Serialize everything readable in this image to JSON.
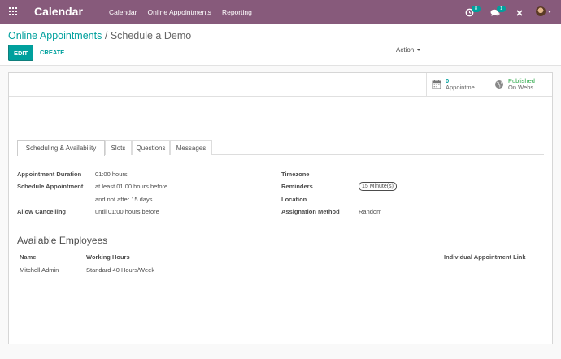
{
  "navbar": {
    "brand": "Calendar",
    "menu": [
      "Calendar",
      "Online Appointments",
      "Reporting"
    ],
    "activity_count": "8",
    "message_count": "1"
  },
  "breadcrumb": {
    "parent": "Online Appointments",
    "separator": "/",
    "current": "Schedule a Demo"
  },
  "controls": {
    "edit_label": "EDIT",
    "create_label": "CREATE",
    "action_label": "Action"
  },
  "smart_buttons": [
    {
      "value": "0",
      "label": "Appointme..."
    },
    {
      "value": "Published",
      "label": "On Webs..."
    }
  ],
  "tabs": [
    "Scheduling & Availability",
    "Slots",
    "Questions",
    "Messages"
  ],
  "fields_left": [
    {
      "label": "Appointment Duration",
      "value": "01:00 hours"
    },
    {
      "label": "Schedule Appointment",
      "value": "at least 01:00 hours before",
      "value2": "and not after 15 days"
    },
    {
      "label": "Allow Cancelling",
      "value": "until 01:00 hours before"
    }
  ],
  "fields_right": [
    {
      "label": "Timezone",
      "value": ""
    },
    {
      "label": "Reminders",
      "value": "15 Minute(s)"
    },
    {
      "label": "Location",
      "value": ""
    },
    {
      "label": "Assignation Method",
      "value": "Random"
    }
  ],
  "employees": {
    "title": "Available Employees",
    "columns": [
      "Name",
      "Working Hours",
      "Individual Appointment Link"
    ],
    "rows": [
      {
        "name": "Mitchell Admin",
        "hours": "Standard 40 Hours/Week",
        "link": ""
      }
    ]
  },
  "colors": {
    "navbar": "#875a7b",
    "accent": "#00a09d",
    "published": "#28a745"
  }
}
